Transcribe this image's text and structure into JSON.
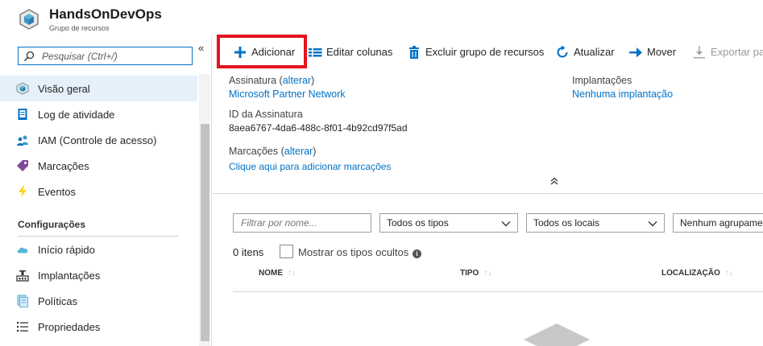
{
  "header": {
    "title": "HandsOnDevOps",
    "subtitle": "Grupo de recursos",
    "icon": "resource-group-cube-icon"
  },
  "sidebar": {
    "search_placeholder": "Pesquisar (Ctrl+/)",
    "collapse_label": "«",
    "items": [
      {
        "label": "Visão geral",
        "icon": "overview-cube-icon",
        "active": true
      },
      {
        "label": "Log de atividade",
        "icon": "activity-log-icon"
      },
      {
        "label": "IAM (Controle de acesso)",
        "icon": "people-icon"
      },
      {
        "label": "Marcações",
        "icon": "tag-icon"
      },
      {
        "label": "Eventos",
        "icon": "lightning-icon"
      }
    ],
    "section_title": "Configurações",
    "settings_items": [
      {
        "label": "Início rápido",
        "icon": "cloud-icon"
      },
      {
        "label": "Implantações",
        "icon": "deployments-icon"
      },
      {
        "label": "Políticas",
        "icon": "policy-icon"
      },
      {
        "label": "Propriedades",
        "icon": "properties-icon"
      }
    ]
  },
  "toolbar": {
    "add_label": "Adicionar",
    "edit_columns_label": "Editar colunas",
    "delete_label": "Excluir grupo de recursos",
    "refresh_label": "Atualizar",
    "move_label": "Mover",
    "export_label": "Exportar pa"
  },
  "essentials": {
    "subscription_label": "Assinatura",
    "change_link": "alterar",
    "subscription_value": "Microsoft Partner Network",
    "subscription_id_label": "ID da Assinatura",
    "subscription_id_value": "8aea6767-4da6-488c-8f01-4b92cd97f5ad",
    "tags_label": "Marcações",
    "tags_change_link": "alterar",
    "tags_add_link": "Clique aqui para adicionar marcações",
    "deployments_label": "Implantações",
    "deployments_value": "Nenhuma implantação",
    "collapse_chevron": "⌃"
  },
  "filters": {
    "name_placeholder": "Filtrar por nome...",
    "type_select": "Todos os tipos",
    "location_select": "Todos os locais",
    "grouping_select": "Nenhum agrupamento"
  },
  "list": {
    "count_text": "0 itens",
    "show_hidden_label": "Mostrar os tipos ocultos",
    "info_icon": "info-icon",
    "columns": [
      "NOME",
      "TIPO",
      "LOCALIZAÇÃO"
    ],
    "sort_glyph": "↑↓"
  },
  "colors": {
    "accent": "#0072c6",
    "highlight_border": "#e3141c",
    "active_nav_bg": "#e6f0fa"
  }
}
